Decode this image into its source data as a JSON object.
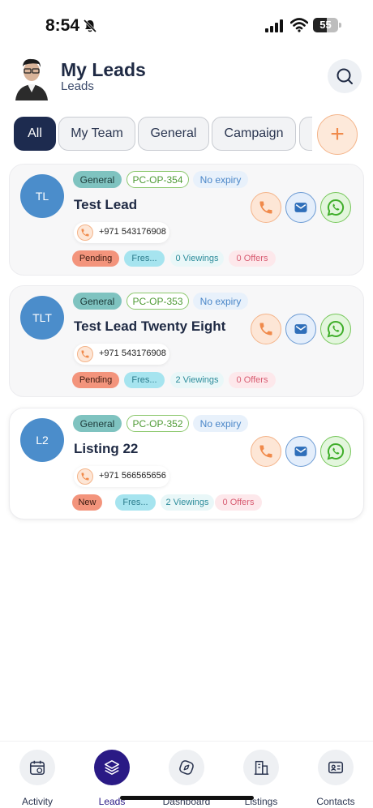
{
  "status_bar": {
    "time": "8:54",
    "battery_level": "55"
  },
  "header": {
    "title": "My Leads",
    "subtitle": "Leads"
  },
  "tabs": [
    {
      "label": "All",
      "active": true
    },
    {
      "label": "My Team",
      "active": false
    },
    {
      "label": "General",
      "active": false
    },
    {
      "label": "Campaign",
      "active": false
    }
  ],
  "leads": [
    {
      "initials": "TL",
      "type": "General",
      "code": "PC-OP-354",
      "expiry": "No expiry",
      "name": "Test Lead",
      "phone": "+971 543176908",
      "status": "Pending",
      "source": "Fres...",
      "viewings": "0 Viewings",
      "offers": "0 Offers"
    },
    {
      "initials": "TLT",
      "type": "General",
      "code": "PC-OP-353",
      "expiry": "No expiry",
      "name": "Test Lead Twenty Eight",
      "phone": "+971 543176908",
      "status": "Pending",
      "source": "Fres...",
      "viewings": "2 Viewings",
      "offers": "0 Offers"
    },
    {
      "initials": "L2",
      "type": "General",
      "code": "PC-OP-352",
      "expiry": "No expiry",
      "name": "Listing 22",
      "phone": "+971 566565656",
      "status": "New",
      "source": "Fres...",
      "viewings": "2 Viewings",
      "offers": "0 Offers"
    }
  ],
  "bottom_nav": [
    {
      "label": "Activity",
      "icon": "calendar-icon",
      "active": false
    },
    {
      "label": "Leads",
      "icon": "layers-icon",
      "active": true
    },
    {
      "label": "Dashboard",
      "icon": "compass-icon",
      "active": false
    },
    {
      "label": "Listings",
      "icon": "building-icon",
      "active": false
    },
    {
      "label": "Contacts",
      "icon": "contact-card-icon",
      "active": false
    }
  ],
  "colors": {
    "accent": "#2a1a85",
    "navy": "#1d2b4f",
    "avatar_blue": "#4b8dcb",
    "orange": "#f08a4b"
  }
}
